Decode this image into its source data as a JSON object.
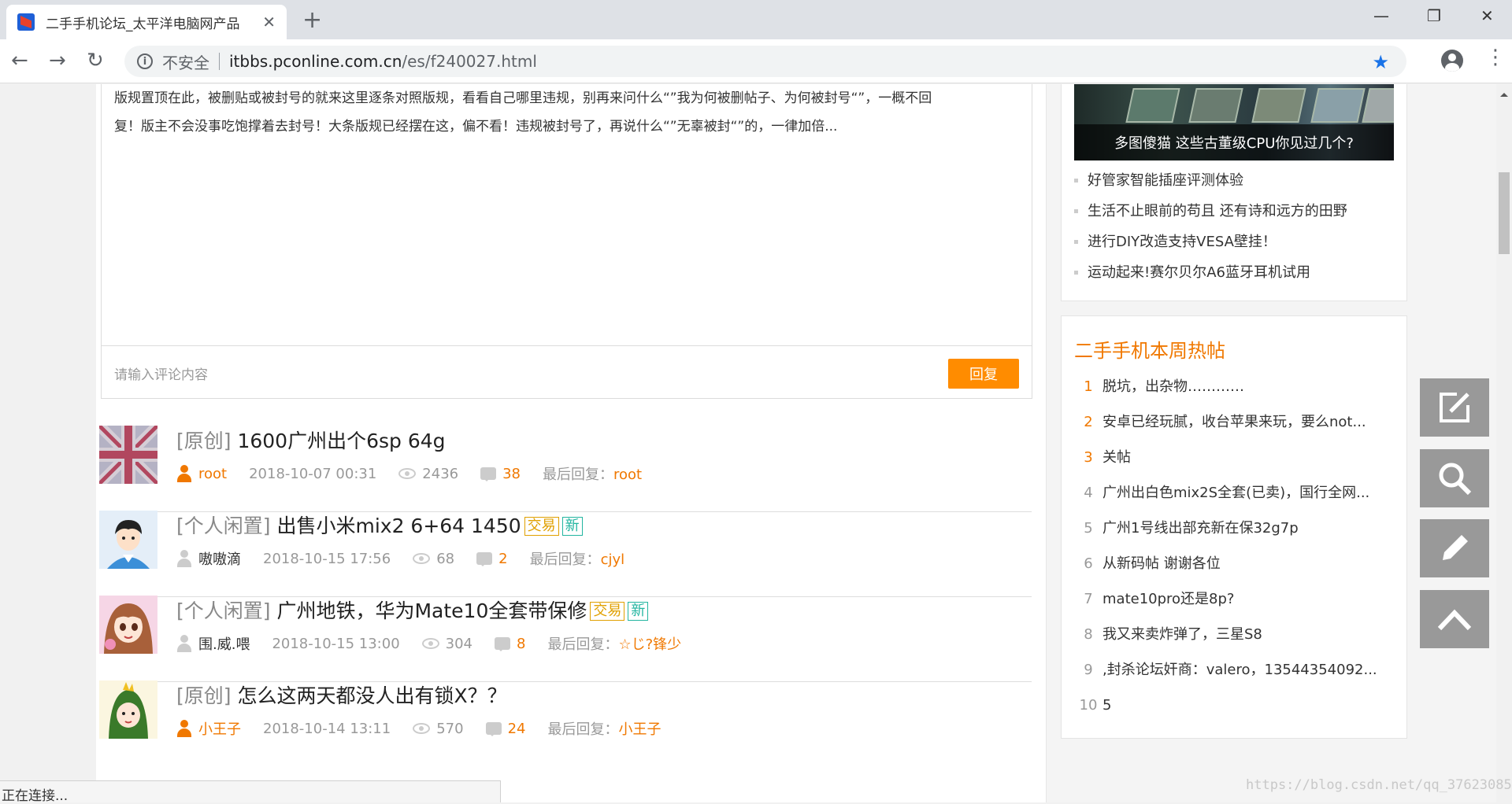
{
  "browser": {
    "tab_title": "二手手机论坛_太平洋电脑网产品",
    "insecure_label": "不安全",
    "url_host": "itbbs.pconline.com.cn",
    "url_path": "/es/f240027.html",
    "status_text": "正在连接...",
    "watermark": "https://blog.csdn.net/qq_37623085"
  },
  "rules": {
    "line1": "版规置顶在此，被删贴或被封号的就来这里逐条对照版规，看看自己哪里违规，别再来问什么“”我为何被删帖子、为何被封号“”，一概不回",
    "line2": "复！版主不会没事吃饱撑着去封号！大条版规已经摆在这，偏不看！违规被封号了，再说什么“”无辜被封“”的，一律加倍...",
    "reply_placeholder": "请输入评论内容",
    "reply_button": "回复"
  },
  "threads": [
    {
      "category": "[原创]",
      "title": "1600广州出个6sp 64g",
      "tags": [],
      "author": "root",
      "date": "2018-10-07 00:31",
      "views": "2436",
      "replies": "38",
      "last_reply_label": "最后回复：",
      "last_reply_user": "root"
    },
    {
      "category": "[个人闲置]",
      "title": "出售小米mix2 6+64 1450",
      "tags": [
        "交易",
        "新"
      ],
      "author": "嗷嗷滴",
      "date": "2018-10-15 17:56",
      "views": "68",
      "replies": "2",
      "last_reply_label": "最后回复：",
      "last_reply_user": "cjyl"
    },
    {
      "category": "[个人闲置]",
      "title": "广州地铁，华为Mate10全套带保修",
      "tags": [
        "交易",
        "新"
      ],
      "author": "围.威.喂",
      "date": "2018-10-15 13:00",
      "views": "304",
      "replies": "8",
      "last_reply_label": "最后回复：",
      "last_reply_user": "☆じ?锋少"
    },
    {
      "category": "[原创]",
      "title": "怎么这两天都没人出有锁X？？",
      "tags": [],
      "author": "小王子",
      "date": "2018-10-14 13:11",
      "views": "570",
      "replies": "24",
      "last_reply_label": "最后回复：",
      "last_reply_user": "小王子"
    }
  ],
  "sidebar": {
    "feature_caption": "多图傻猫 这些古董级CPU你见过几个?",
    "links": [
      "好管家智能插座评测体验",
      "生活不止眼前的苟且 还有诗和远方的田野",
      "进行DIY改造支持VESA壁挂！",
      "运动起来!赛尔贝尔A6蓝牙耳机试用"
    ],
    "hot_title": "二手手机本周热帖",
    "hot_posts": [
      {
        "rank": "1",
        "title": "脱坑，出杂物…………"
      },
      {
        "rank": "2",
        "title": "安卓已经玩腻，收台苹果来玩，要么not..."
      },
      {
        "rank": "3",
        "title": "关帖"
      },
      {
        "rank": "4",
        "title": "广州出白色mix2S全套(已卖)，国行全网..."
      },
      {
        "rank": "5",
        "title": "广州1号线出部充新在保32g7p"
      },
      {
        "rank": "6",
        "title": "从新码帖 谢谢各位"
      },
      {
        "rank": "7",
        "title": "mate10pro还是8p?"
      },
      {
        "rank": "8",
        "title": "我又来卖炸弹了，三星S8"
      },
      {
        "rank": "9",
        "title": ",封杀论坛奸商：valero，13544354092..."
      },
      {
        "rank": "10",
        "title": "5"
      }
    ]
  },
  "float_buttons": [
    "edit-square-icon",
    "search-icon",
    "pencil-icon",
    "back-to-top-icon"
  ]
}
